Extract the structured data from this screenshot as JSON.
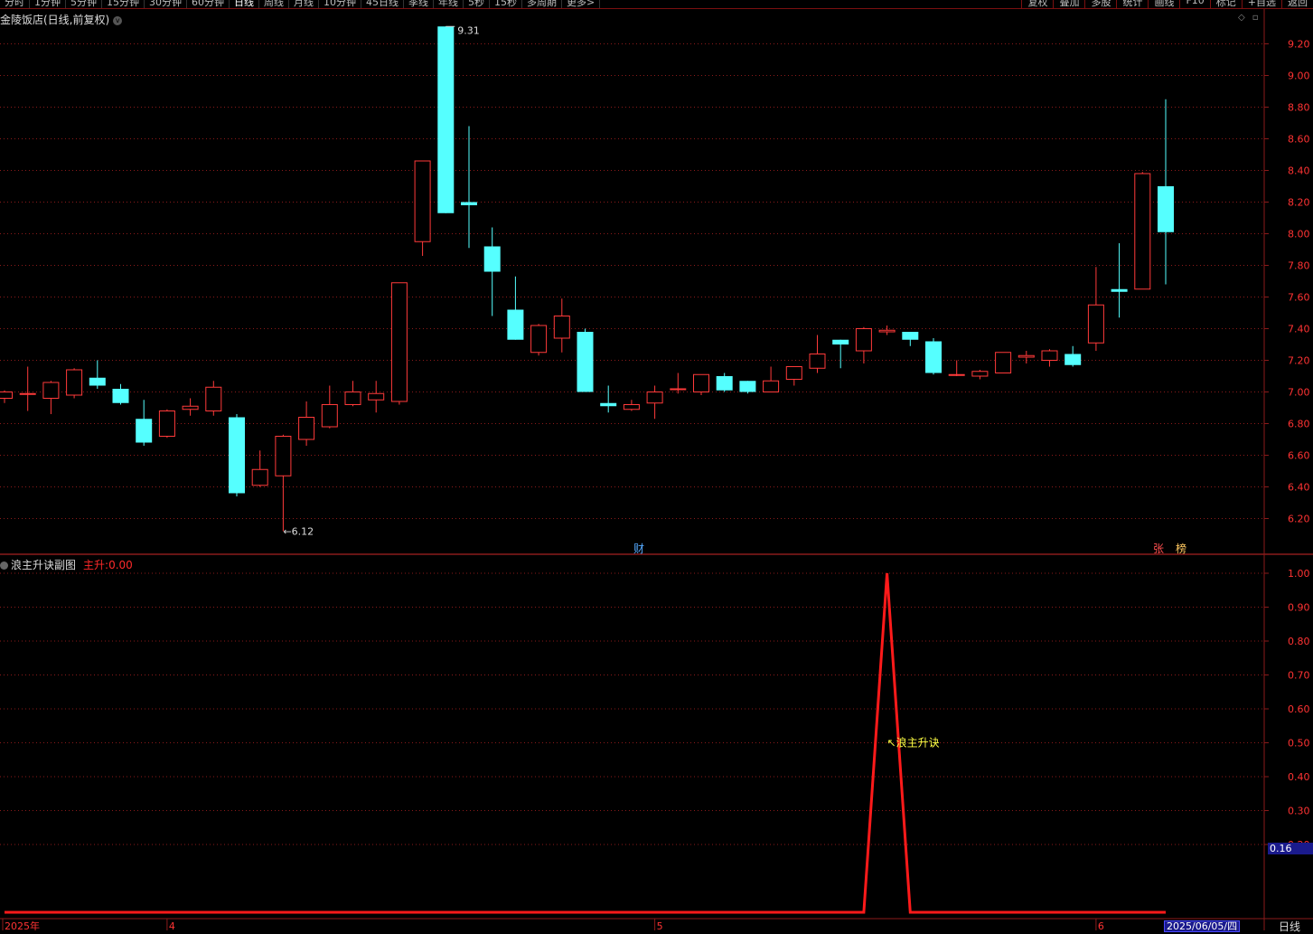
{
  "toolbar": {
    "periods": [
      "分时",
      "1分钟",
      "5分钟",
      "15分钟",
      "30分钟",
      "60分钟",
      "日线",
      "周线",
      "月线",
      "10分钟",
      "45日线",
      "季线",
      "年线",
      "5秒",
      "15秒",
      "多周期",
      "更多>"
    ],
    "active_period": "日线",
    "tools": [
      "复权",
      "叠加",
      "多股",
      "统计",
      "画线",
      "F10",
      "标记",
      "+自选",
      "返回"
    ]
  },
  "main_title": "金陵饭店(日线,前复权)",
  "sub_title": {
    "name": "浪主升诀副图",
    "label": "主升:",
    "value": "0.00"
  },
  "markers": {
    "cai": "财",
    "zhang": "张",
    "bang": "榜"
  },
  "annotations": {
    "high": "9.31",
    "low": "←6.12",
    "signal": "↖浪主升诀"
  },
  "current_value_tag": "0.16",
  "date_tag": "2025/06/05/四",
  "period_tag": "日线",
  "colors": {
    "up": "#ff3a3a",
    "down": "#55ffff",
    "grid": "#8b1a1a",
    "indicator": "#ff1a1a",
    "signal": "#ffff44"
  },
  "chart_data": [
    {
      "type": "candlestick",
      "title": "金陵饭店(日线,前复权)",
      "ylim": [
        6.1,
        9.3
      ],
      "yticks": [
        "9.20",
        "9.00",
        "8.80",
        "8.60",
        "8.40",
        "8.20",
        "8.00",
        "7.80",
        "7.60",
        "7.40",
        "7.20",
        "7.00",
        "6.80",
        "6.60",
        "6.40",
        "6.20"
      ],
      "xticks": [
        {
          "label": "2025年",
          "index": 0
        },
        {
          "label": "4",
          "index": 7
        },
        {
          "label": "5",
          "index": 28
        },
        {
          "label": "6",
          "index": 47
        }
      ],
      "series": [
        {
          "open": 6.96,
          "close": 7.0,
          "high": 7.01,
          "low": 6.93
        },
        {
          "open": 6.99,
          "close": 6.99,
          "high": 7.16,
          "low": 6.88
        },
        {
          "open": 6.96,
          "close": 7.06,
          "high": 7.07,
          "low": 6.86
        },
        {
          "open": 6.98,
          "close": 7.14,
          "high": 7.15,
          "low": 6.96
        },
        {
          "open": 7.09,
          "close": 7.04,
          "high": 7.2,
          "low": 7.02
        },
        {
          "open": 7.02,
          "close": 6.93,
          "high": 7.05,
          "low": 6.92
        },
        {
          "open": 6.83,
          "close": 6.68,
          "high": 6.95,
          "low": 6.66
        },
        {
          "open": 6.72,
          "close": 6.88,
          "high": 6.89,
          "low": 6.71
        },
        {
          "open": 6.89,
          "close": 6.91,
          "high": 6.96,
          "low": 6.85
        },
        {
          "open": 6.88,
          "close": 7.03,
          "high": 7.07,
          "low": 6.85
        },
        {
          "open": 6.84,
          "close": 6.36,
          "high": 6.86,
          "low": 6.34
        },
        {
          "open": 6.41,
          "close": 6.51,
          "high": 6.63,
          "low": 6.4
        },
        {
          "open": 6.47,
          "close": 6.72,
          "high": 6.73,
          "low": 6.12
        },
        {
          "open": 6.7,
          "close": 6.84,
          "high": 6.94,
          "low": 6.66
        },
        {
          "open": 6.78,
          "close": 6.92,
          "high": 7.04,
          "low": 6.77
        },
        {
          "open": 6.92,
          "close": 7.0,
          "high": 7.07,
          "low": 6.91
        },
        {
          "open": 6.95,
          "close": 6.99,
          "high": 7.07,
          "low": 6.87
        },
        {
          "open": 6.94,
          "close": 7.69,
          "high": 7.69,
          "low": 6.92
        },
        {
          "open": 7.95,
          "close": 8.46,
          "high": 8.46,
          "low": 7.86
        },
        {
          "open": 9.31,
          "close": 8.13,
          "high": 9.31,
          "low": 8.13
        },
        {
          "open": 8.2,
          "close": 8.18,
          "high": 8.68,
          "low": 7.91
        },
        {
          "open": 7.92,
          "close": 7.76,
          "high": 8.04,
          "low": 7.48
        },
        {
          "open": 7.52,
          "close": 7.33,
          "high": 7.73,
          "low": 7.33
        },
        {
          "open": 7.25,
          "close": 7.42,
          "high": 7.43,
          "low": 7.23
        },
        {
          "open": 7.34,
          "close": 7.48,
          "high": 7.59,
          "low": 7.25
        },
        {
          "open": 7.38,
          "close": 7.0,
          "high": 7.4,
          "low": 7.0
        },
        {
          "open": 6.93,
          "close": 6.91,
          "high": 7.04,
          "low": 6.87
        },
        {
          "open": 6.89,
          "close": 6.92,
          "high": 6.95,
          "low": 6.88
        },
        {
          "open": 6.93,
          "close": 7.0,
          "high": 7.04,
          "low": 6.83
        },
        {
          "open": 7.02,
          "close": 7.02,
          "high": 7.12,
          "low": 6.99
        },
        {
          "open": 7.0,
          "close": 7.11,
          "high": 7.11,
          "low": 6.98
        },
        {
          "open": 7.1,
          "close": 7.01,
          "high": 7.12,
          "low": 7.0
        },
        {
          "open": 7.07,
          "close": 7.0,
          "high": 7.07,
          "low": 6.99
        },
        {
          "open": 7.0,
          "close": 7.07,
          "high": 7.16,
          "low": 7.0
        },
        {
          "open": 7.08,
          "close": 7.16,
          "high": 7.16,
          "low": 7.04
        },
        {
          "open": 7.15,
          "close": 7.24,
          "high": 7.36,
          "low": 7.12
        },
        {
          "open": 7.33,
          "close": 7.3,
          "high": 7.33,
          "low": 7.15
        },
        {
          "open": 7.26,
          "close": 7.4,
          "high": 7.41,
          "low": 7.18
        },
        {
          "open": 7.38,
          "close": 7.39,
          "high": 7.42,
          "low": 7.36
        },
        {
          "open": 7.38,
          "close": 7.33,
          "high": 7.38,
          "low": 7.29
        },
        {
          "open": 7.32,
          "close": 7.12,
          "high": 7.34,
          "low": 7.11
        },
        {
          "open": 7.11,
          "close": 7.11,
          "high": 7.2,
          "low": 7.1
        },
        {
          "open": 7.1,
          "close": 7.13,
          "high": 7.14,
          "low": 7.08
        },
        {
          "open": 7.12,
          "close": 7.25,
          "high": 7.25,
          "low": 7.12
        },
        {
          "open": 7.22,
          "close": 7.23,
          "high": 7.26,
          "low": 7.18
        },
        {
          "open": 7.2,
          "close": 7.26,
          "high": 7.27,
          "low": 7.16
        },
        {
          "open": 7.24,
          "close": 7.17,
          "high": 7.29,
          "low": 7.16
        },
        {
          "open": 7.31,
          "close": 7.55,
          "high": 7.79,
          "low": 7.26
        },
        {
          "open": 7.65,
          "close": 7.64,
          "high": 7.94,
          "low": 7.47
        },
        {
          "open": 7.65,
          "close": 8.38,
          "high": 8.39,
          "low": 7.65
        },
        {
          "open": 8.3,
          "close": 8.01,
          "high": 8.85,
          "low": 7.68
        }
      ]
    },
    {
      "type": "line",
      "title": "浪主升诀副图",
      "ylim": [
        0,
        1.0
      ],
      "yticks": [
        "1.00",
        "0.90",
        "0.80",
        "0.70",
        "0.60",
        "0.50",
        "0.40",
        "0.30",
        "0.20"
      ],
      "series": [
        {
          "name": "主升",
          "values": [
            0,
            0,
            0,
            0,
            0,
            0,
            0,
            0,
            0,
            0,
            0,
            0,
            0,
            0,
            0,
            0,
            0,
            0,
            0,
            0,
            0,
            0,
            0,
            0,
            0,
            0,
            0,
            0,
            0,
            0,
            0,
            0,
            0,
            0,
            0,
            0,
            0,
            0,
            1,
            0,
            0,
            0,
            0,
            0,
            0,
            0,
            0,
            0,
            0,
            0,
            0
          ]
        }
      ]
    }
  ]
}
